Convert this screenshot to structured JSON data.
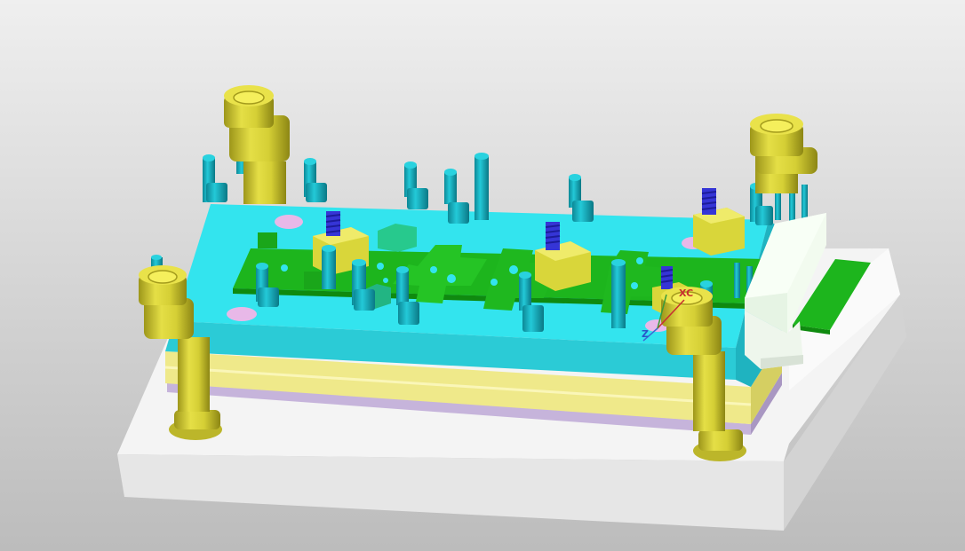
{
  "scene": {
    "background_top": "#efefef",
    "background_bottom": "#bcbcbc",
    "colors": {
      "base_plate": "#f4f4f4",
      "yellow_plate": "#f1ec8c",
      "violet_plate": "#c8b6dc",
      "cyan_plate": "#33e4ee",
      "strip": "#1bb51b",
      "strip_dark": "#0f8a0f",
      "guide_post": "#d9d43a",
      "guide_post_dark": "#a29c1c",
      "pin": "#17b7c7",
      "pin_dark": "#0b7f8c",
      "spring": "#3535d6",
      "punch_block": "#dedc3a",
      "block_white": "#f2fbef"
    },
    "triad_labels": {
      "z": "Z",
      "xc": "XC"
    }
  }
}
